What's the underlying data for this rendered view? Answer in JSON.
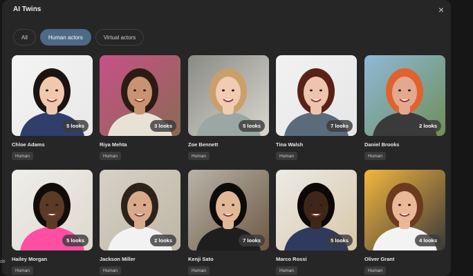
{
  "modal": {
    "title": "AI Twins",
    "close_icon": "×"
  },
  "filters": [
    {
      "label": "All",
      "active": false
    },
    {
      "label": "Human actors",
      "active": true
    },
    {
      "label": "Virtual actors",
      "active": false
    }
  ],
  "actors": [
    {
      "name": "Chloe Adams",
      "looks": "5 looks",
      "tag": "Human",
      "bg": "#f4f4f4",
      "bg2": "#e8e8e8",
      "skin": "#f0c9ad",
      "hair": "#1c1410",
      "shirt": "#2f3e6b"
    },
    {
      "name": "Riya Mehta",
      "looks": "3 looks",
      "tag": "Human",
      "bg": "#c95088",
      "bg2": "#8a6a52",
      "skin": "#c99273",
      "hair": "#2a1c14",
      "shirt": "#e8e2d6"
    },
    {
      "name": "Zoe Bennett",
      "looks": "5 looks",
      "tag": "Human",
      "bg": "#8a8a86",
      "bg2": "#d9d7cf",
      "skin": "#f1cbb2",
      "hair": "#c9a06a",
      "shirt": "#9aa7a3"
    },
    {
      "name": "Tina Walsh",
      "looks": "7 looks",
      "tag": "Human",
      "bg": "#f2f2f2",
      "bg2": "#e6e6e6",
      "skin": "#efc4ac",
      "hair": "#5a2118",
      "shirt": "#5b6b7a"
    },
    {
      "name": "Daniel Brooks",
      "looks": "2 looks",
      "tag": "Human",
      "bg": "#8fb8d8",
      "bg2": "#6d8f5a",
      "skin": "#e3a88f",
      "hair": "#e0622e",
      "shirt": "#3a3a3a"
    },
    {
      "name": "Hailey Morgan",
      "looks": "5 looks",
      "tag": "Human",
      "bg": "#efeee9",
      "bg2": "#dcd8cf",
      "skin": "#5b3a26",
      "hair": "#120c08",
      "shirt": "#ff4fa3"
    },
    {
      "name": "Jackson Miller",
      "looks": "2 looks",
      "tag": "Human",
      "bg": "#d7d2c6",
      "bg2": "#bdb6a6",
      "skin": "#d9a98c",
      "hair": "#2e231b",
      "shirt": "#f2f2f2"
    },
    {
      "name": "Kenji Sato",
      "looks": "7 looks",
      "tag": "Human",
      "bg": "#b9b3a8",
      "bg2": "#6c5844",
      "skin": "#e2b796",
      "hair": "#0e0c0b",
      "shirt": "#1e1e1e"
    },
    {
      "name": "Marco Rossi",
      "looks": "5 looks",
      "tag": "Human",
      "bg": "#ecebe7",
      "bg2": "#d7c7a8",
      "skin": "#3e2718",
      "hair": "#0c0806",
      "shirt": "#2e3b5f"
    },
    {
      "name": "Oliver Grant",
      "looks": "4 looks",
      "tag": "Human",
      "bg": "#f4b63d",
      "bg2": "#3a3a3a",
      "skin": "#eab899",
      "hair": "#6b3a1f",
      "shirt": "#f3f3f3"
    }
  ],
  "edge_text": "de"
}
